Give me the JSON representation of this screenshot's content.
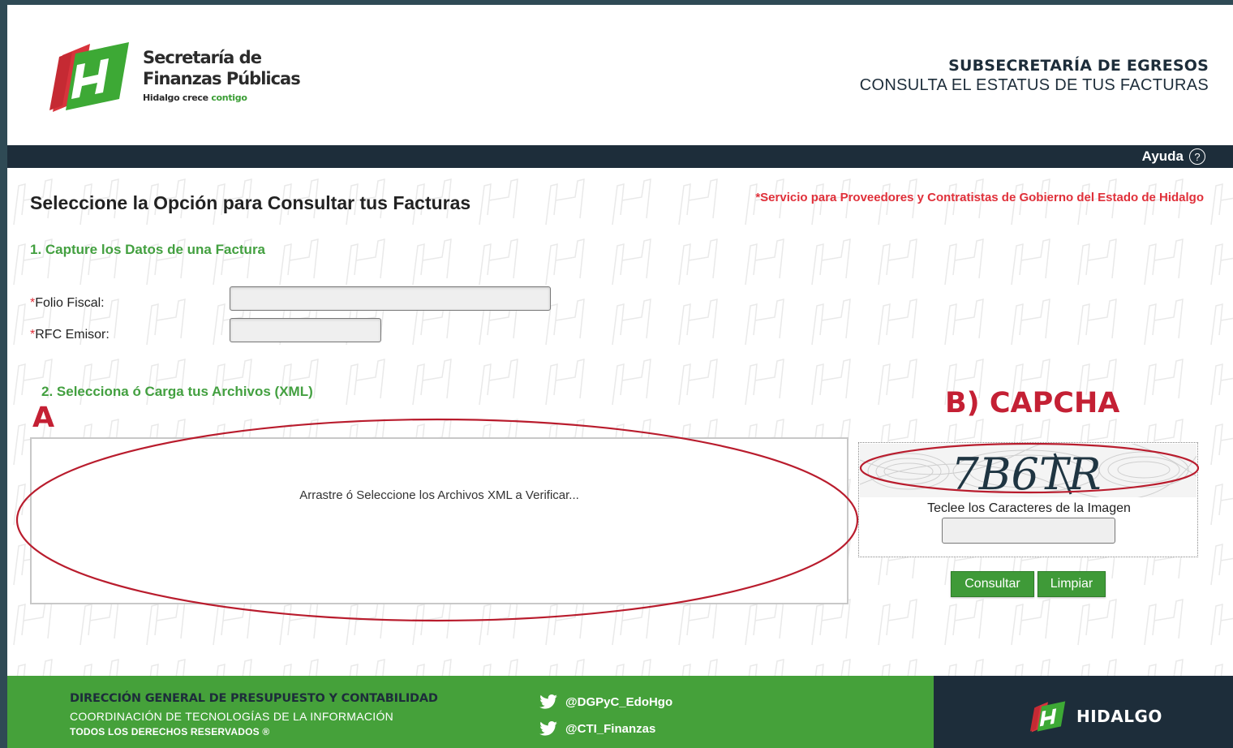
{
  "header": {
    "logo_line1": "Secretaría de",
    "logo_line2": "Finanzas Públicas",
    "logo_tag_dark": "Hidalgo crece",
    "logo_tag_green": "contigo",
    "subsecretaria": "SUBSECRETARÍA DE EGRESOS",
    "subtitle": "CONSULTA EL ESTATUS DE TUS FACTURAS"
  },
  "navbar": {
    "help_label": "Ayuda",
    "help_icon": "?"
  },
  "main": {
    "title": "Seleccione la Opción para Consultar tus Facturas",
    "service_note": "*Servicio para Proveedores y Contratistas de Gobierno del Estado de Hidalgo",
    "section1_title": "1. Capture los Datos de una Factura",
    "folio": {
      "required_mark": "*",
      "label": "Folio Fiscal:",
      "value": ""
    },
    "rfc": {
      "required_mark": "*",
      "label": "RFC Emisor:",
      "value": ""
    },
    "section2_title": "2. Selecciona ó Carga tus Archivos (XML)",
    "annotation_a": "A",
    "annotation_b": "B) CAPCHA",
    "dropzone_text": "Arrastre ó Seleccione los Archivos XML a Verificar...",
    "captcha": {
      "code": "7B6TR",
      "label": "Teclee los Caracteres de la Imagen",
      "value": ""
    },
    "consultar_label": "Consultar",
    "limpiar_label": "Limpiar"
  },
  "footer": {
    "line1": "DIRECCIÓN GENERAL DE PRESUPUESTO Y CONTABILIDAD",
    "line2": "COORDINACIÓN DE TECNOLOGÍAS DE LA INFORMACIÓN",
    "line3": "TODOS LOS DERECHOS RESERVADOS ®",
    "twitter1": "@DGPyC_EdoHgo",
    "twitter2": "@CTI_Finanzas",
    "brand": "HIDALGO"
  },
  "colors": {
    "accent_green": "#45a13a",
    "dark_navy": "#1d2d3a",
    "alert_red": "#e0303a",
    "annotation_red": "#c42034"
  }
}
